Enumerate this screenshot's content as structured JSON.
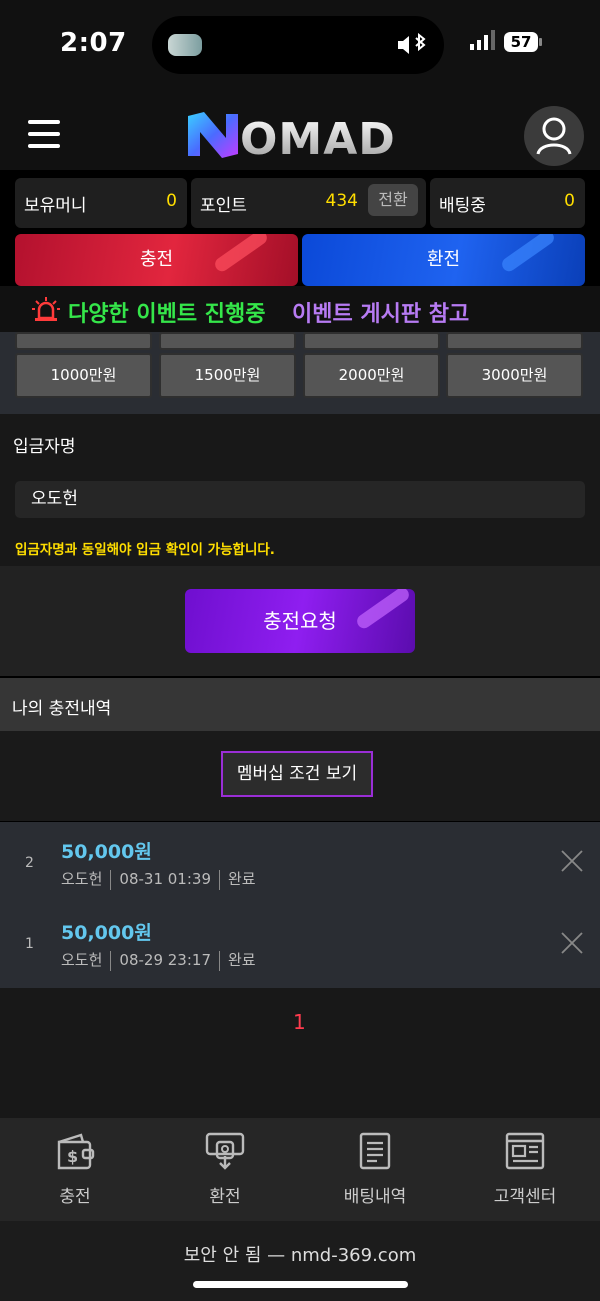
{
  "status": {
    "time": "2:07",
    "battery": "57"
  },
  "header": {
    "logo": "NOMAD"
  },
  "wallet": {
    "money_label": "보유머니",
    "money_value": "0",
    "point_label": "포인트",
    "point_value": "434",
    "convert_label": "전환",
    "betting_label": "배팅중",
    "betting_value": "0"
  },
  "actions": {
    "deposit": "충전",
    "withdraw": "환전"
  },
  "notice": {
    "text1": "다양한 이벤트 진행중",
    "text2": "이벤트 게시판 참고"
  },
  "amounts": [
    "1000만원",
    "1500만원",
    "2000만원",
    "3000만원"
  ],
  "depositor": {
    "label": "입금자명",
    "value": "오도헌",
    "warning": "입금자명과 동일해야 입금 확인이 가능합니다."
  },
  "request_button": "충전요청",
  "history": {
    "title": "나의 충전내역",
    "membership_button": "멤버십 조건 보기",
    "rows": [
      {
        "num": "2",
        "amount": "50,000원",
        "name": "오도헌",
        "date": "08-31 01:39",
        "status": "완료"
      },
      {
        "num": "1",
        "amount": "50,000원",
        "name": "오도헌",
        "date": "08-29 23:17",
        "status": "완료"
      }
    ],
    "page": "1"
  },
  "nav": [
    {
      "label": "충전",
      "icon": "wallet-dollar-icon"
    },
    {
      "label": "환전",
      "icon": "atm-withdraw-icon"
    },
    {
      "label": "배팅내역",
      "icon": "document-list-icon"
    },
    {
      "label": "고객센터",
      "icon": "newspaper-icon"
    }
  ],
  "browser": {
    "url": "보안 안 됨 — nmd-369.com"
  },
  "colors": {
    "accent_yellow": "#ffde00",
    "money_blue": "#63c7ee",
    "page_red": "#ff3b4e",
    "notice_green": "#35e64a",
    "notice_purple": "#b77bf3"
  }
}
